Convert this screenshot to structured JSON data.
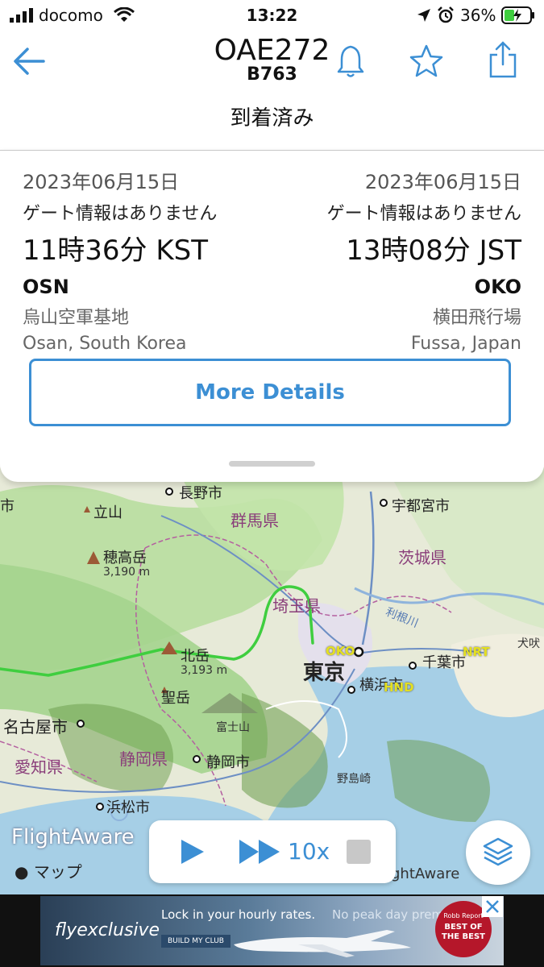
{
  "status_bar": {
    "carrier": "docomo",
    "time": "13:22",
    "battery": "36%"
  },
  "header": {
    "flight": "OAE272",
    "aircraft": "B763"
  },
  "flight_status": "到着済み",
  "departure": {
    "date": "2023年06月15日",
    "gate": "ゲート情報はありません",
    "time": "11時36分 KST",
    "code": "OSN",
    "airport": "烏山空軍基地",
    "city": "Osan, South Korea"
  },
  "arrival": {
    "date": "2023年06月15日",
    "gate": "ゲート情報はありません",
    "time": "13時08分 JST",
    "code": "OKO",
    "airport": "横田飛行場",
    "city": "Fussa, Japan"
  },
  "more_details_label": "More Details",
  "map": {
    "labels": {
      "nagano": "長野市",
      "tateyama": "立山",
      "utsunomiya": "宇都宮市",
      "gunma": "群馬県",
      "hotaka": "穂高岳",
      "hotaka_elev": "3,190 m",
      "ibaraki": "茨城県",
      "saitama": "埼玉県",
      "tonegawa": "利根川",
      "inubo": "犬吠",
      "kitadake": "北岳",
      "kitadake_elev": "3,193 m",
      "oko": "OKO",
      "tokyo": "東京",
      "chiba": "千葉市",
      "nrt": "NRT",
      "yokohama": "横浜市",
      "hnd": "HND",
      "hijiridake": "聖岳",
      "nagoya": "名古屋市",
      "fuji": "富士山",
      "aichi": "愛知県",
      "shizuoka_pref": "静岡県",
      "shizuoka_city": "静岡市",
      "nojimazaki": "野島崎",
      "hamamatsu": "浜松市",
      "left_edge": "市",
      "attribution": "ightAware"
    },
    "brand": "FlightAware",
    "map_provider": "マップ",
    "playback_speed": "10x"
  },
  "ad": {
    "brand": "flyexclusive",
    "headline": "Lock in your hourly rates.",
    "headline_tail": "No peak day premiums.",
    "cta": "BUILD MY CLUB",
    "badge_top": "Robb Report",
    "badge_title": "BEST OF THE BEST"
  },
  "colors": {
    "accent": "#3c8fd4",
    "route": "#3fce3f"
  }
}
